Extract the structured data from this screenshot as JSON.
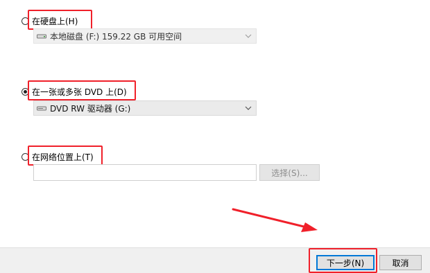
{
  "options": {
    "hard_disk": {
      "label": "在硬盘上(H)",
      "selected": false,
      "drive_select": {
        "value": "本地磁盘 (F:)  159.22 GB 可用空间",
        "icon": "hard-drive-icon",
        "disabled": true
      }
    },
    "dvd": {
      "label": "在一张或多张 DVD 上(D)",
      "selected": true,
      "drive_select": {
        "value": "DVD RW 驱动器 (G:)",
        "icon": "dvd-drive-icon",
        "disabled": false
      }
    },
    "network": {
      "label": "在网络位置上(T)",
      "selected": false,
      "path_input": {
        "value": "",
        "placeholder": ""
      },
      "browse_button": {
        "label": "选择(S)...",
        "disabled": true
      }
    }
  },
  "footer": {
    "next_button": "下一步(N)",
    "cancel_button": "取消"
  },
  "annotation": {
    "highlight_color": "#f0202a",
    "arrow": "pointing toward 下一步(N) button"
  },
  "colors": {
    "accent": "#0078d7",
    "annotation_red": "#f0202a",
    "footer_bg": "#f0f0f0"
  }
}
